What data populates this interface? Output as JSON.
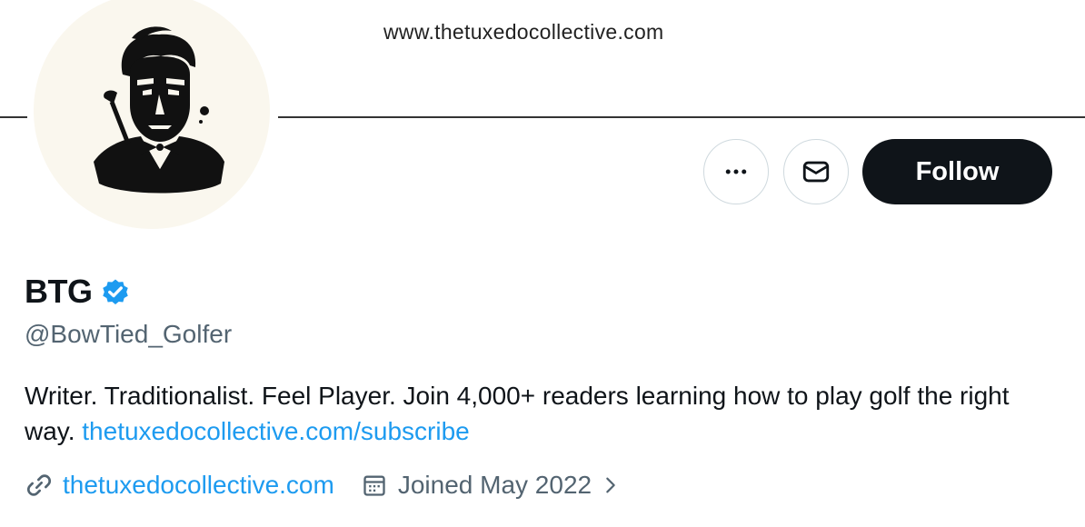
{
  "banner": {
    "url_text": "www.thetuxedocollective.com"
  },
  "profile": {
    "display_name": "BTG",
    "handle": "@BowTied_Golfer",
    "bio_text": "Writer. Traditionalist. Feel Player. Join 4,000+ readers learning how to play golf the right way. ",
    "bio_link": "thetuxedocollective.com/subscribe",
    "website": "thetuxedocollective.com",
    "joined": "Joined May 2022",
    "verified": true
  },
  "actions": {
    "more_icon": "ellipsis-icon",
    "message_icon": "envelope-icon",
    "follow_label": "Follow"
  },
  "colors": {
    "link": "#1d9bf0",
    "follow_bg": "#0f1419",
    "verified_badge": "#1d9bf0",
    "secondary_text": "#536471"
  }
}
